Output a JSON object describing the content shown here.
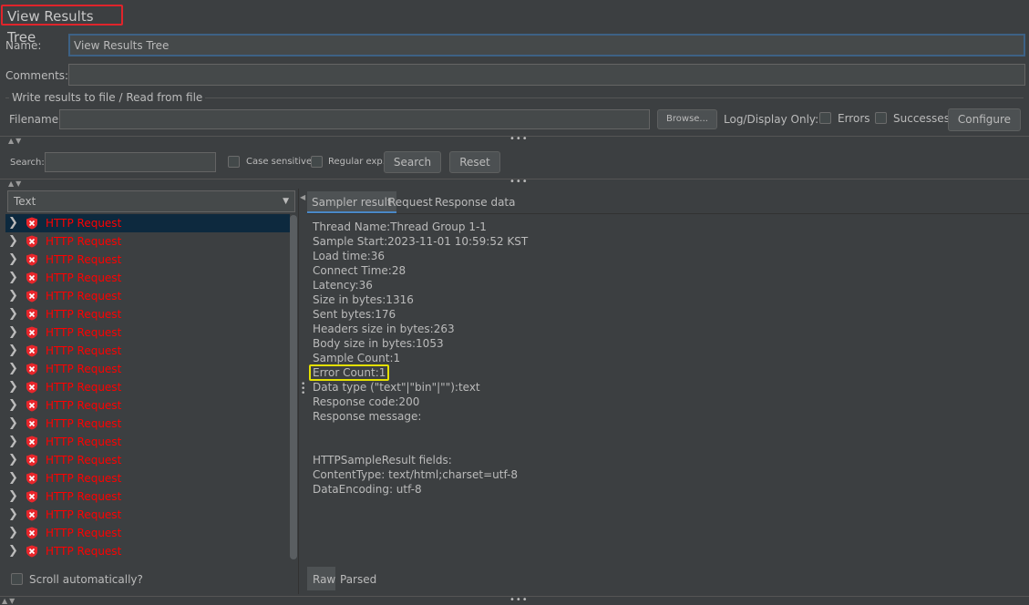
{
  "title": "View Results Tree",
  "name": {
    "label": "Name:",
    "value": "View Results Tree"
  },
  "comments": {
    "label": "Comments:",
    "value": ""
  },
  "file_section": {
    "legend": "Write results to file / Read from file",
    "filename_label": "Filename",
    "filename_value": "",
    "browse_label": "Browse...",
    "log_display_label": "Log/Display Only:",
    "errors_label": "Errors",
    "successes_label": "Successes",
    "configure_label": "Configure"
  },
  "search": {
    "label": "Search:",
    "value": "",
    "case_sensitive_label": "Case sensitive",
    "regex_label": "Regular exp.",
    "search_button": "Search",
    "reset_button": "Reset"
  },
  "renderer": {
    "selected": "Text"
  },
  "tree": {
    "items": [
      "HTTP Request",
      "HTTP Request",
      "HTTP Request",
      "HTTP Request",
      "HTTP Request",
      "HTTP Request",
      "HTTP Request",
      "HTTP Request",
      "HTTP Request",
      "HTTP Request",
      "HTTP Request",
      "HTTP Request",
      "HTTP Request",
      "HTTP Request",
      "HTTP Request",
      "HTTP Request",
      "HTTP Request",
      "HTTP Request",
      "HTTP Request"
    ],
    "scroll_auto_label": "Scroll automatically?"
  },
  "tabs": {
    "sampler": "Sampler result",
    "request": "Request",
    "response": "Response data"
  },
  "details": [
    "Thread Name:Thread Group 1-1",
    "Sample Start:2023-11-01 10:59:52 KST",
    "Load time:36",
    "Connect Time:28",
    "Latency:36",
    "Size in bytes:1316",
    "Sent bytes:176",
    "Headers size in bytes:263",
    "Body size in bytes:1053",
    "Sample Count:1",
    "Error Count:1",
    "Data type (\"text\"|\"bin\"|\"\"):text",
    "Response code:200",
    "Response message:",
    "",
    "",
    "HTTPSampleResult fields:",
    "ContentType: text/html;charset=utf-8",
    "DataEncoding: utf-8"
  ],
  "bottom_tabs": {
    "raw": "Raw",
    "parsed": "Parsed"
  },
  "colors": {
    "error_text": "#ff0000",
    "highlight_box": "#e4e000",
    "title_box": "#e0242b"
  }
}
